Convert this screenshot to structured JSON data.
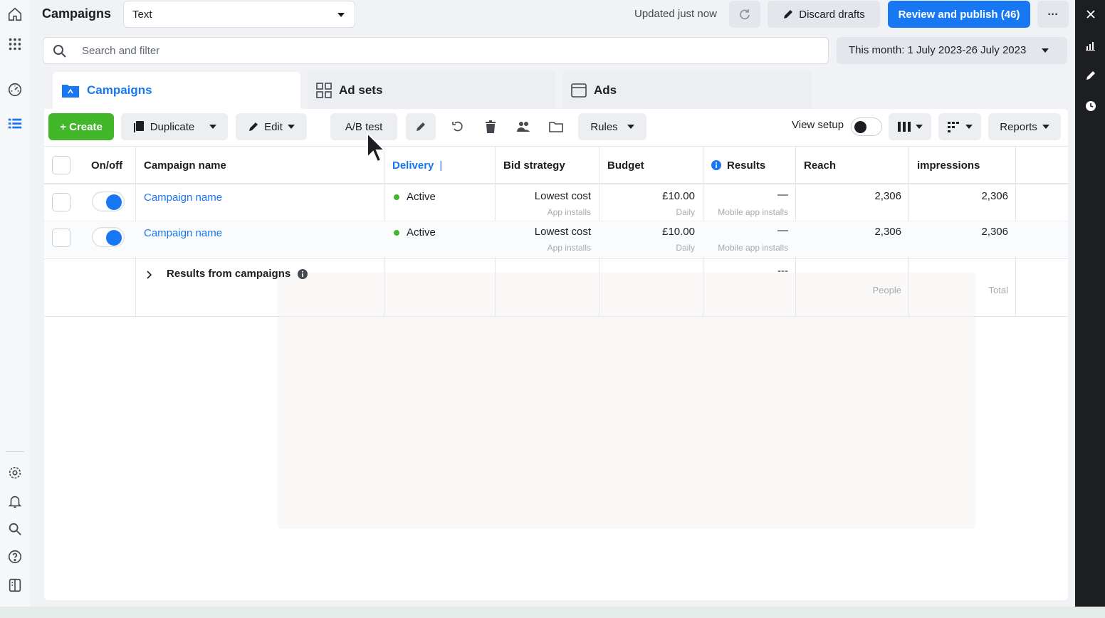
{
  "header": {
    "title": "Campaigns",
    "selector_value": "Text",
    "updated_status": "Updated just now",
    "discard_label": "Discard drafts",
    "publish_label": "Review and publish (46)",
    "more_label": "···"
  },
  "search": {
    "placeholder": "Search and filter",
    "date_range": "This month: 1 July 2023-26 July 2023"
  },
  "tabs": [
    {
      "label": "Campaigns",
      "active": true
    },
    {
      "label": "Ad sets",
      "active": false
    },
    {
      "label": "Ads",
      "active": false
    }
  ],
  "toolbar": {
    "create_label": "+ Create",
    "duplicate_label": "Duplicate",
    "edit_label": "Edit",
    "ab_test_label": "A/B test",
    "rules_label": "Rules",
    "view_setup_label": "View setup",
    "reports_label": "Reports"
  },
  "table": {
    "columns": [
      "On/off",
      "Campaign name",
      "Delivery",
      "Bid strategy",
      "Budget",
      "Results",
      "Reach",
      "impressions"
    ],
    "rows": [
      {
        "name": "Campaign name",
        "delivery": "Active",
        "bid_strategy": "Lowest cost",
        "bid_sub": "App installs",
        "budget": "£10.00",
        "budget_sub": "Daily",
        "results": "—",
        "results_sub": "Mobile app installs",
        "reach": "2,306",
        "impressions": "2,306",
        "on": true
      },
      {
        "name": "Campaign name",
        "delivery": "Active",
        "bid_strategy": "Lowest cost",
        "bid_sub": "App installs",
        "budget": "£10.00",
        "budget_sub": "Daily",
        "results": "—",
        "results_sub": "Mobile app installs",
        "reach": "2,306",
        "impressions": "2,306",
        "on": true
      }
    ],
    "summary": {
      "label": "Results from campaigns",
      "results": "---",
      "reach_sub": "People",
      "impressions_sub": "Total"
    }
  },
  "colors": {
    "accent": "#1877f2",
    "create_green": "#42b72a",
    "active_dot": "#42b72a"
  }
}
